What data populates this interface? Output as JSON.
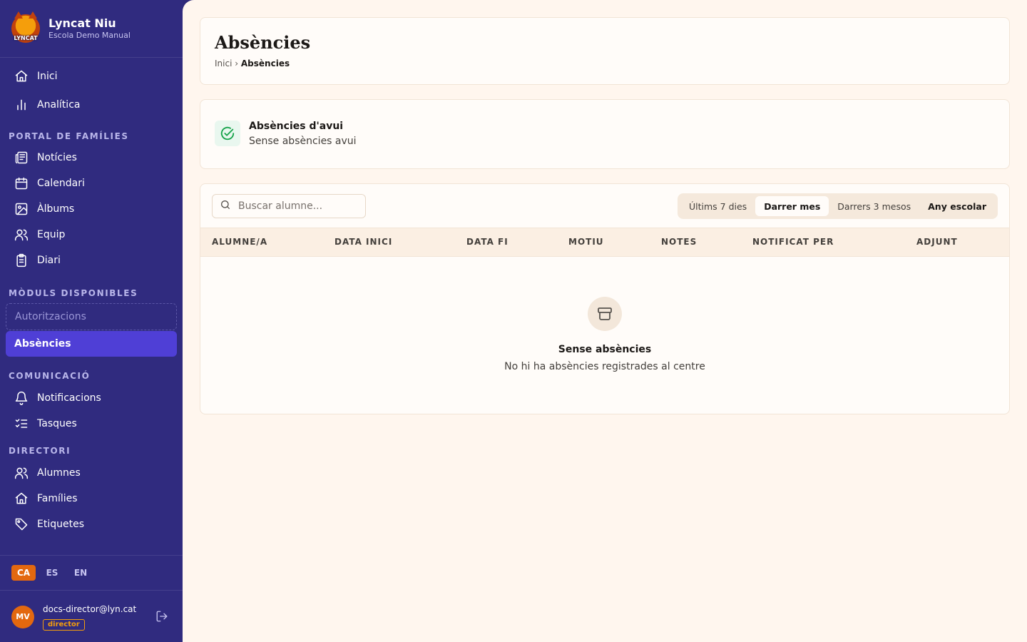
{
  "brand": {
    "logo_text": "LYNCAT",
    "name": "Lyncat Niu",
    "school": "Escola Demo Manual"
  },
  "sidebar": {
    "top_items": [
      {
        "label": "Inici",
        "icon": "home-icon"
      },
      {
        "label": "Analítica",
        "icon": "bar-chart-icon"
      }
    ],
    "sections": [
      {
        "title": "PORTAL DE FAMÍLIES",
        "items": [
          {
            "label": "Notícies",
            "icon": "newspaper-icon"
          },
          {
            "label": "Calendari",
            "icon": "calendar-icon"
          },
          {
            "label": "Àlbums",
            "icon": "image-icon"
          },
          {
            "label": "Equip",
            "icon": "users-icon"
          },
          {
            "label": "Diari",
            "icon": "clipboard-icon"
          }
        ]
      },
      {
        "title": "MÒDULS DISPONIBLES",
        "items": [
          {
            "label": "Autoritzacions",
            "state": "available"
          },
          {
            "label": "Absències",
            "state": "active"
          }
        ]
      },
      {
        "title": "COMUNICACIÓ",
        "items": [
          {
            "label": "Notificacions",
            "icon": "bell-icon"
          },
          {
            "label": "Tasques",
            "icon": "list-checks-icon"
          }
        ]
      },
      {
        "title": "DIRECTORI",
        "items": [
          {
            "label": "Alumnes",
            "icon": "users-icon"
          },
          {
            "label": "Famílies",
            "icon": "home-icon"
          },
          {
            "label": "Etiquetes",
            "icon": "tag-icon"
          }
        ]
      }
    ],
    "languages": [
      "CA",
      "ES",
      "EN"
    ],
    "active_language": "CA",
    "user": {
      "initials": "MV",
      "email": "docs-director@lyn.cat",
      "role": "director"
    }
  },
  "page": {
    "title": "Absències",
    "breadcrumb": {
      "root": "Inici",
      "separator": "›",
      "current": "Absències"
    }
  },
  "today": {
    "title": "Absències d'avui",
    "subtitle": "Sense absències avui",
    "icon": "check-circle-icon"
  },
  "table": {
    "search_placeholder": "Buscar alumne...",
    "ranges": [
      "Últims 7 dies",
      "Darrer mes",
      "Darrers 3 mesos",
      "Any escolar"
    ],
    "active_range": "Darrer mes",
    "columns": [
      "ALUMNE/A",
      "DATA INICI",
      "DATA FI",
      "MOTIU",
      "NOTES",
      "NOTIFICAT PER",
      "ADJUNT"
    ],
    "empty": {
      "icon": "archive-icon",
      "title": "Sense absències",
      "subtitle": "No hi ha absències registrades al centre"
    }
  },
  "colors": {
    "sidebar": "#302b7f",
    "active_item": "#4f3fd6",
    "accent": "#e3680f",
    "background": "#fff6ee",
    "success": "#16a34a"
  }
}
